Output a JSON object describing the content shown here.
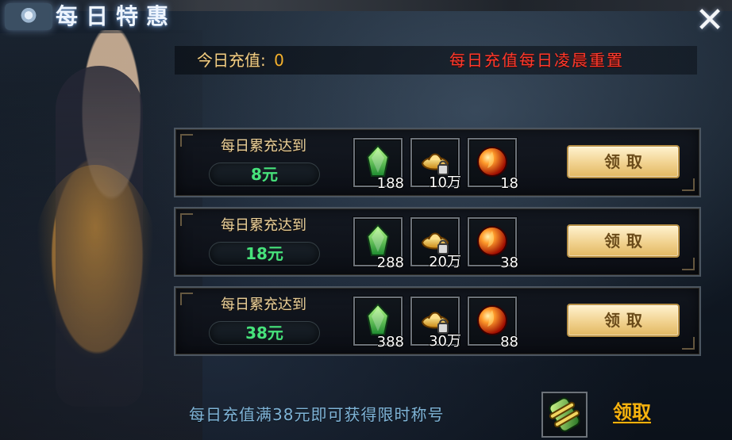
{
  "header": {
    "title": "每日特惠",
    "close_glyph": "✕"
  },
  "summary": {
    "today_recharge_label": "今日充值:",
    "today_recharge_value": "0",
    "reset_note": "每日充值每日凌晨重置"
  },
  "tiers": [
    {
      "title": "每日累充达到",
      "amount": "8元",
      "rewards": [
        {
          "icon": "green-crystal-icon",
          "count": "188"
        },
        {
          "icon": "gold-ingot-icon",
          "count": "10万"
        },
        {
          "icon": "red-orb-icon",
          "count": "18"
        }
      ],
      "button_label": "领取"
    },
    {
      "title": "每日累充达到",
      "amount": "18元",
      "rewards": [
        {
          "icon": "green-crystal-icon",
          "count": "288"
        },
        {
          "icon": "gold-ingot-icon",
          "count": "20万"
        },
        {
          "icon": "red-orb-icon",
          "count": "38"
        }
      ],
      "button_label": "领取"
    },
    {
      "title": "每日累充达到",
      "amount": "38元",
      "rewards": [
        {
          "icon": "green-crystal-icon",
          "count": "388"
        },
        {
          "icon": "gold-ingot-icon",
          "count": "30万"
        },
        {
          "icon": "red-orb-icon",
          "count": "88"
        }
      ],
      "button_label": "领取"
    }
  ],
  "footer": {
    "message": "每日充值满38元即可获得限时称号",
    "reward_icon": "scroll-icon",
    "claim_label": "领取"
  },
  "colors": {
    "accent_gold": "#f2cf86",
    "reset_red": "#ff3a2c",
    "amount_green": "#47e37b",
    "footer_blue": "#7fb3d6",
    "footer_claim_yellow": "#f5b20f"
  }
}
